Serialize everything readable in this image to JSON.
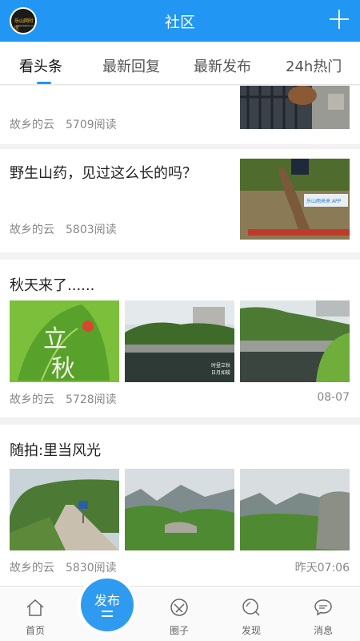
{
  "header": {
    "title": "社区",
    "logo_text": "乐山网社区",
    "logo_sub": "www.leshan.cn"
  },
  "tabs": [
    {
      "label": "看头条",
      "active": true
    },
    {
      "label": "最新回复",
      "active": false
    },
    {
      "label": "最新发布",
      "active": false
    },
    {
      "label": "24h热门",
      "active": false
    }
  ],
  "posts": [
    {
      "title": "",
      "author": "故乡的云",
      "views": "5709阅读",
      "date": ""
    },
    {
      "title": "野生山药，见过这么长的吗？",
      "author": "故乡的云",
      "views": "5803阅读",
      "date": "",
      "image_caption": "乐山雨来来 APP"
    },
    {
      "title": "秋天来了......",
      "author": "故乡的云",
      "views": "5728阅读",
      "date": "08-07",
      "image_texts": [
        "立",
        "秋",
        "时昼立秋",
        "日月如梭"
      ]
    },
    {
      "title": "随拍:里当风光",
      "author": "故乡的云",
      "views": "5830阅读",
      "date": "昨天07:06"
    }
  ],
  "bottom_nav": {
    "home": "首页",
    "publish": "发布",
    "circle": "圈子",
    "discover": "发现",
    "messages": "消息"
  },
  "colors": {
    "primary": "#2196F3",
    "text_secondary": "#888888"
  }
}
